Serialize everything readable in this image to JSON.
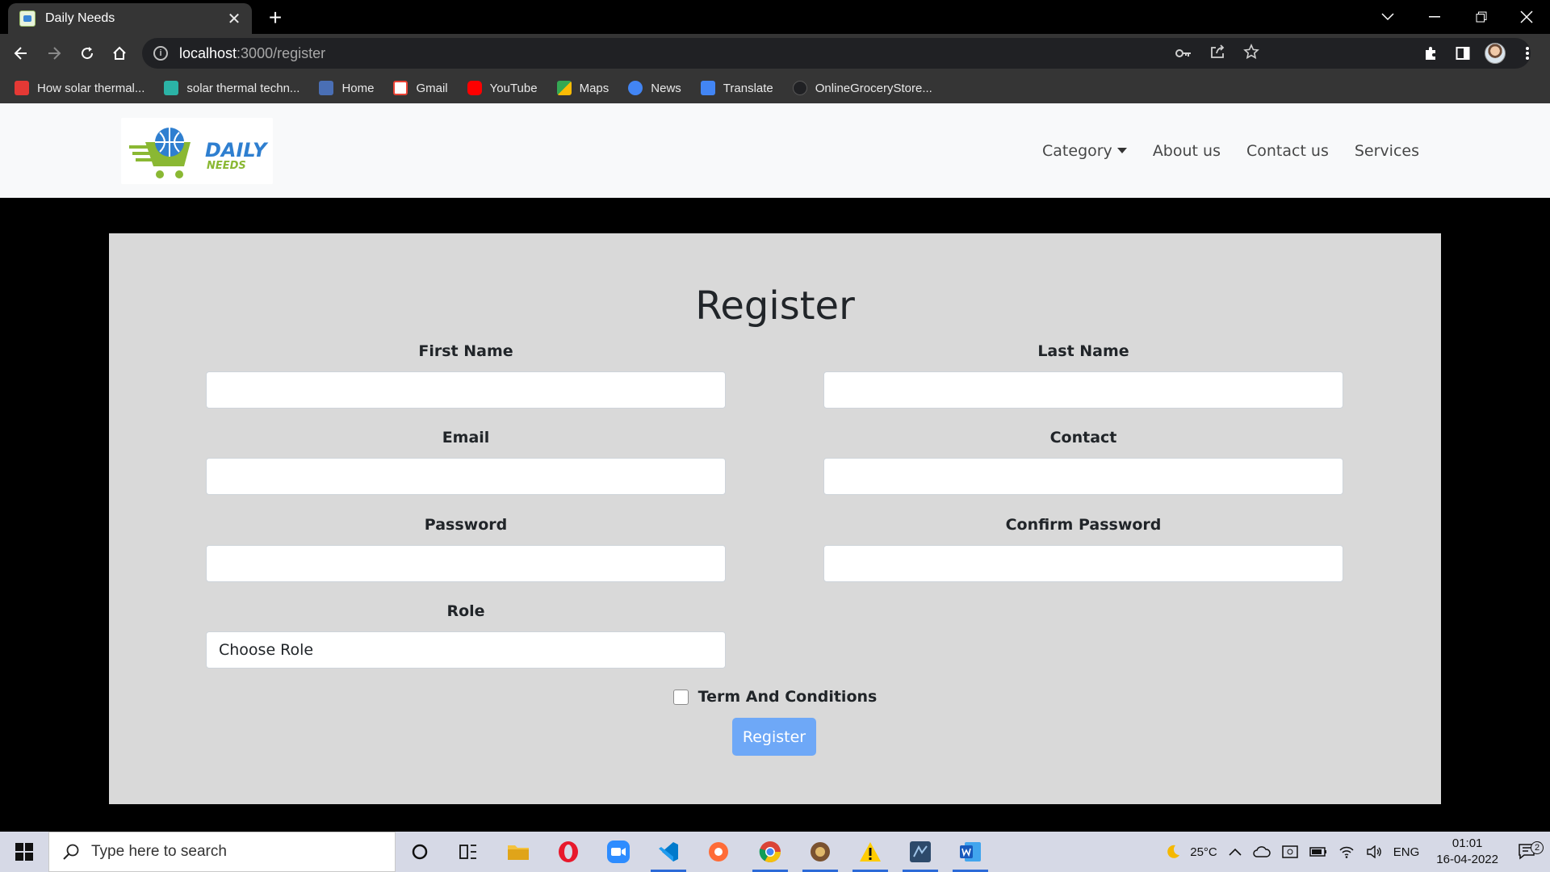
{
  "browser": {
    "tab_title": "Daily Needs",
    "url_host": "localhost",
    "url_path": ":3000/register",
    "bookmarks": [
      {
        "label": "How solar thermal...",
        "color": "#e53935"
      },
      {
        "label": "solar thermal techn...",
        "color": "#2bb3a6"
      },
      {
        "label": "Home",
        "color": "#4a6fb5"
      },
      {
        "label": "Gmail",
        "color": "#ea4335"
      },
      {
        "label": "YouTube",
        "color": "#ff0000"
      },
      {
        "label": "Maps",
        "color": "#34a853"
      },
      {
        "label": "News",
        "color": "#4285f4"
      },
      {
        "label": "Translate",
        "color": "#4285f4"
      },
      {
        "label": "OnlineGroceryStore...",
        "color": "#202124"
      }
    ]
  },
  "navbar": {
    "logo_word1": "DAILY",
    "logo_word2": "NEEDS",
    "items": [
      "Category",
      "About us",
      "Contact us",
      "Services"
    ]
  },
  "form": {
    "title": "Register",
    "first_name_label": "First Name",
    "last_name_label": "Last Name",
    "email_label": "Email",
    "contact_label": "Contact",
    "password_label": "Password",
    "confirm_password_label": "Confirm Password",
    "role_label": "Role",
    "role_value": "Choose Role",
    "terms_label": "Term And Conditions",
    "submit_label": "Register"
  },
  "taskbar": {
    "search_placeholder": "Type here to search",
    "weather": "25°C",
    "language": "ENG",
    "time": "01:01",
    "date": "16-04-2022",
    "notification_count": "2"
  }
}
